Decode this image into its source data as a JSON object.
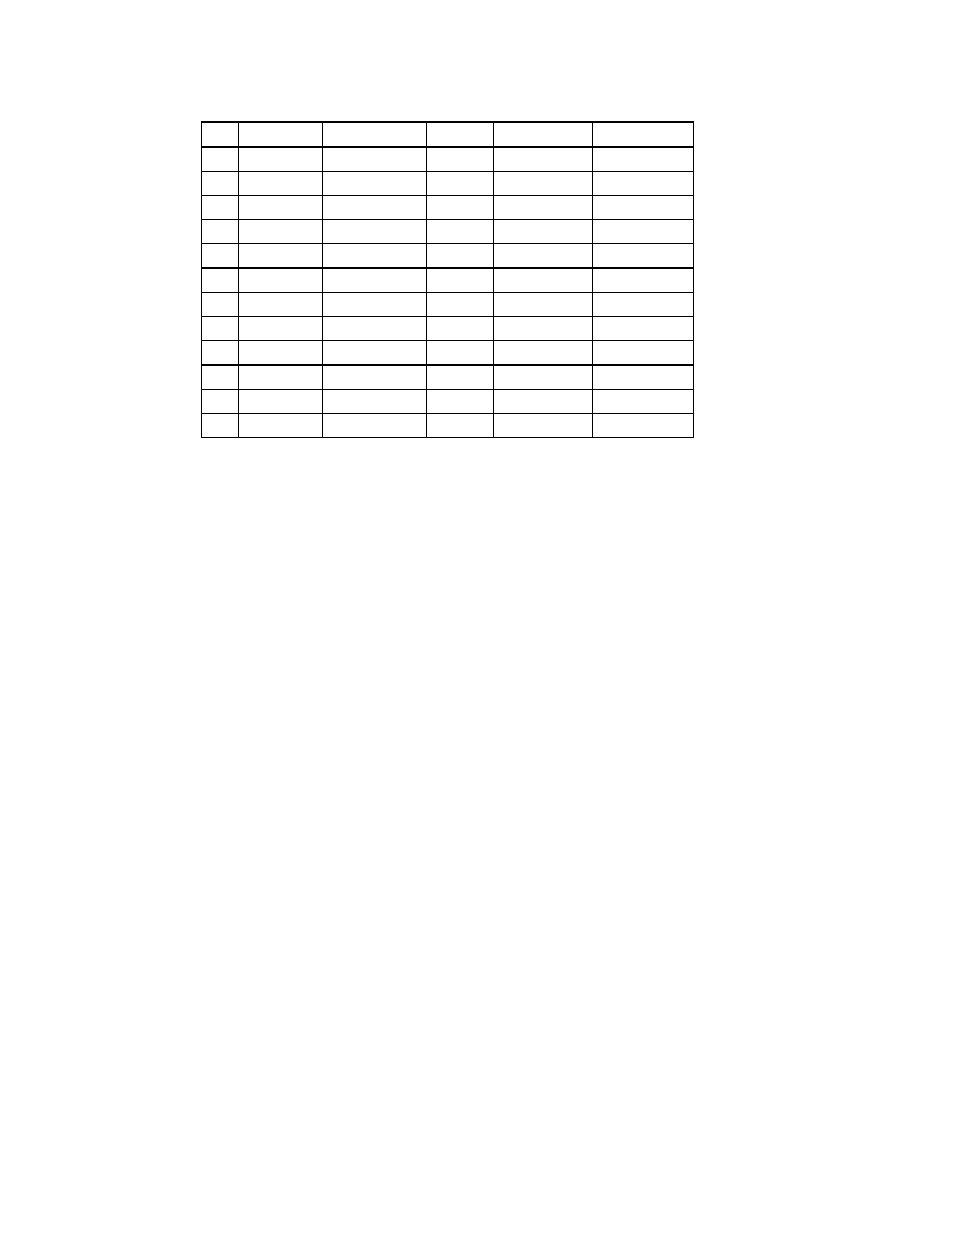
{
  "table": {
    "columns": [
      {
        "label": ""
      },
      {
        "label": ""
      },
      {
        "label": ""
      },
      {
        "label": ""
      },
      {
        "label": ""
      },
      {
        "label": ""
      }
    ],
    "rows": [
      {
        "cells": [
          "",
          "",
          "",
          "",
          "",
          ""
        ],
        "type": "header"
      },
      {
        "cells": [
          "",
          "",
          "",
          "",
          "",
          ""
        ],
        "type": "body"
      },
      {
        "cells": [
          "",
          "",
          "",
          "",
          "",
          ""
        ],
        "type": "body"
      },
      {
        "cells": [
          "",
          "",
          "",
          "",
          "",
          ""
        ],
        "type": "body"
      },
      {
        "cells": [
          "",
          "",
          "",
          "",
          "",
          ""
        ],
        "type": "body"
      },
      {
        "cells": [
          "",
          "",
          "",
          "",
          "",
          ""
        ],
        "type": "body-end"
      },
      {
        "cells": [
          "",
          "",
          "",
          "",
          "",
          ""
        ],
        "type": "body"
      },
      {
        "cells": [
          "",
          "",
          "",
          "",
          "",
          ""
        ],
        "type": "body"
      },
      {
        "cells": [
          "",
          "",
          "",
          "",
          "",
          ""
        ],
        "type": "body"
      },
      {
        "cells": [
          "",
          "",
          "",
          "",
          "",
          ""
        ],
        "type": "body-end"
      },
      {
        "cells": [
          "",
          "",
          "",
          "",
          "",
          ""
        ],
        "type": "body"
      },
      {
        "cells": [
          "",
          "",
          "",
          "",
          "",
          ""
        ],
        "type": "body"
      },
      {
        "cells": [
          "",
          "",
          "",
          "",
          "",
          ""
        ],
        "type": "body"
      }
    ]
  }
}
